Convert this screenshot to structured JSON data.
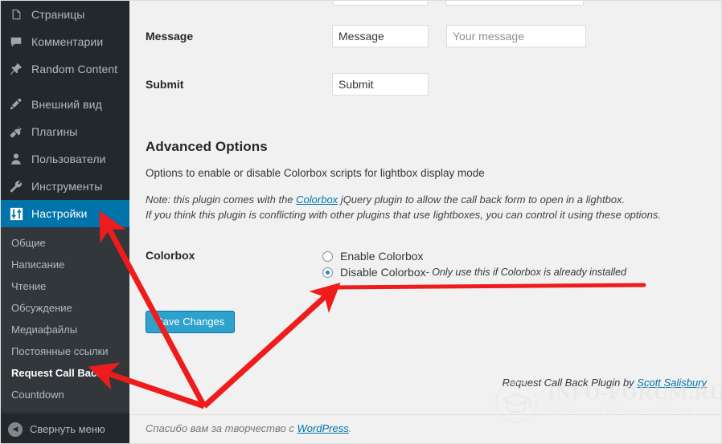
{
  "sidebar": {
    "menu_items": [
      {
        "label": "Страницы",
        "icon": "pages-icon",
        "active": false,
        "spaced": false
      },
      {
        "label": "Комментарии",
        "icon": "comments-icon",
        "active": false,
        "spaced": false
      },
      {
        "label": "Random Content",
        "icon": "pin-icon",
        "active": false,
        "spaced": false
      },
      {
        "label": "Внешний вид",
        "icon": "paintbrush-icon",
        "active": false,
        "spaced": true
      },
      {
        "label": "Плагины",
        "icon": "plug-icon",
        "active": false,
        "spaced": false
      },
      {
        "label": "Пользователи",
        "icon": "user-icon",
        "active": false,
        "spaced": false
      },
      {
        "label": "Инструменты",
        "icon": "wrench-icon",
        "active": false,
        "spaced": false
      },
      {
        "label": "Настройки",
        "icon": "sliders-icon",
        "active": true,
        "spaced": false
      }
    ],
    "submenu_items": [
      {
        "label": "Общие",
        "current": false
      },
      {
        "label": "Написание",
        "current": false
      },
      {
        "label": "Чтение",
        "current": false
      },
      {
        "label": "Обсуждение",
        "current": false
      },
      {
        "label": "Медиафайлы",
        "current": false
      },
      {
        "label": "Постоянные ссылки",
        "current": false
      },
      {
        "label": "Request Call Back",
        "current": true
      },
      {
        "label": "Countdown",
        "current": false
      }
    ],
    "collapse_label": "Свернуть меню",
    "collapse_icon": "chevron-left-circle-icon"
  },
  "main": {
    "message_row": {
      "label": "Message",
      "value": "Message",
      "placeholder_value": "",
      "placeholder_field": "Your message"
    },
    "submit_row": {
      "label": "Submit",
      "value": "Submit"
    },
    "advanced": {
      "title": "Advanced Options",
      "description": "Options to enable or disable Colorbox scripts for lightbox display mode",
      "note_line1_pre": "Note: this plugin comes with the ",
      "note_link": "Colorbox",
      "note_line1_post": " jQuery plugin to allow the call back form to open in a lightbox.",
      "note_line2": "If you think this plugin is conflicting with other plugins that use lightboxes, you can control it using these options."
    },
    "colorbox": {
      "label": "Colorbox",
      "option_enable": "Enable Colorbox",
      "option_disable": "Disable Colorbox",
      "option_disable_hint": " - Only use this if Colorbox is already installed",
      "selected": "disable"
    },
    "save_button": "Save Changes",
    "credit_pre": "Request Call Back Plugin by ",
    "credit_link": "Scott Salisbury"
  },
  "footer": {
    "thanks_pre": "Спасибо вам за творчество с ",
    "thanks_link": "WordPress",
    "thanks_post": "."
  },
  "watermark": {
    "title": "INFO-FORUM.RU",
    "subtitle": "Сообщество Кибермания Рунета"
  },
  "colors": {
    "sidebar_bg": "#23282d",
    "submenu_bg": "#32373c",
    "active_blue": "#0073aa",
    "button_blue": "#2ea2cc",
    "link_blue": "#0073aa",
    "annotation_red": "#ee1c1c",
    "page_bg": "#f1f1f1"
  }
}
